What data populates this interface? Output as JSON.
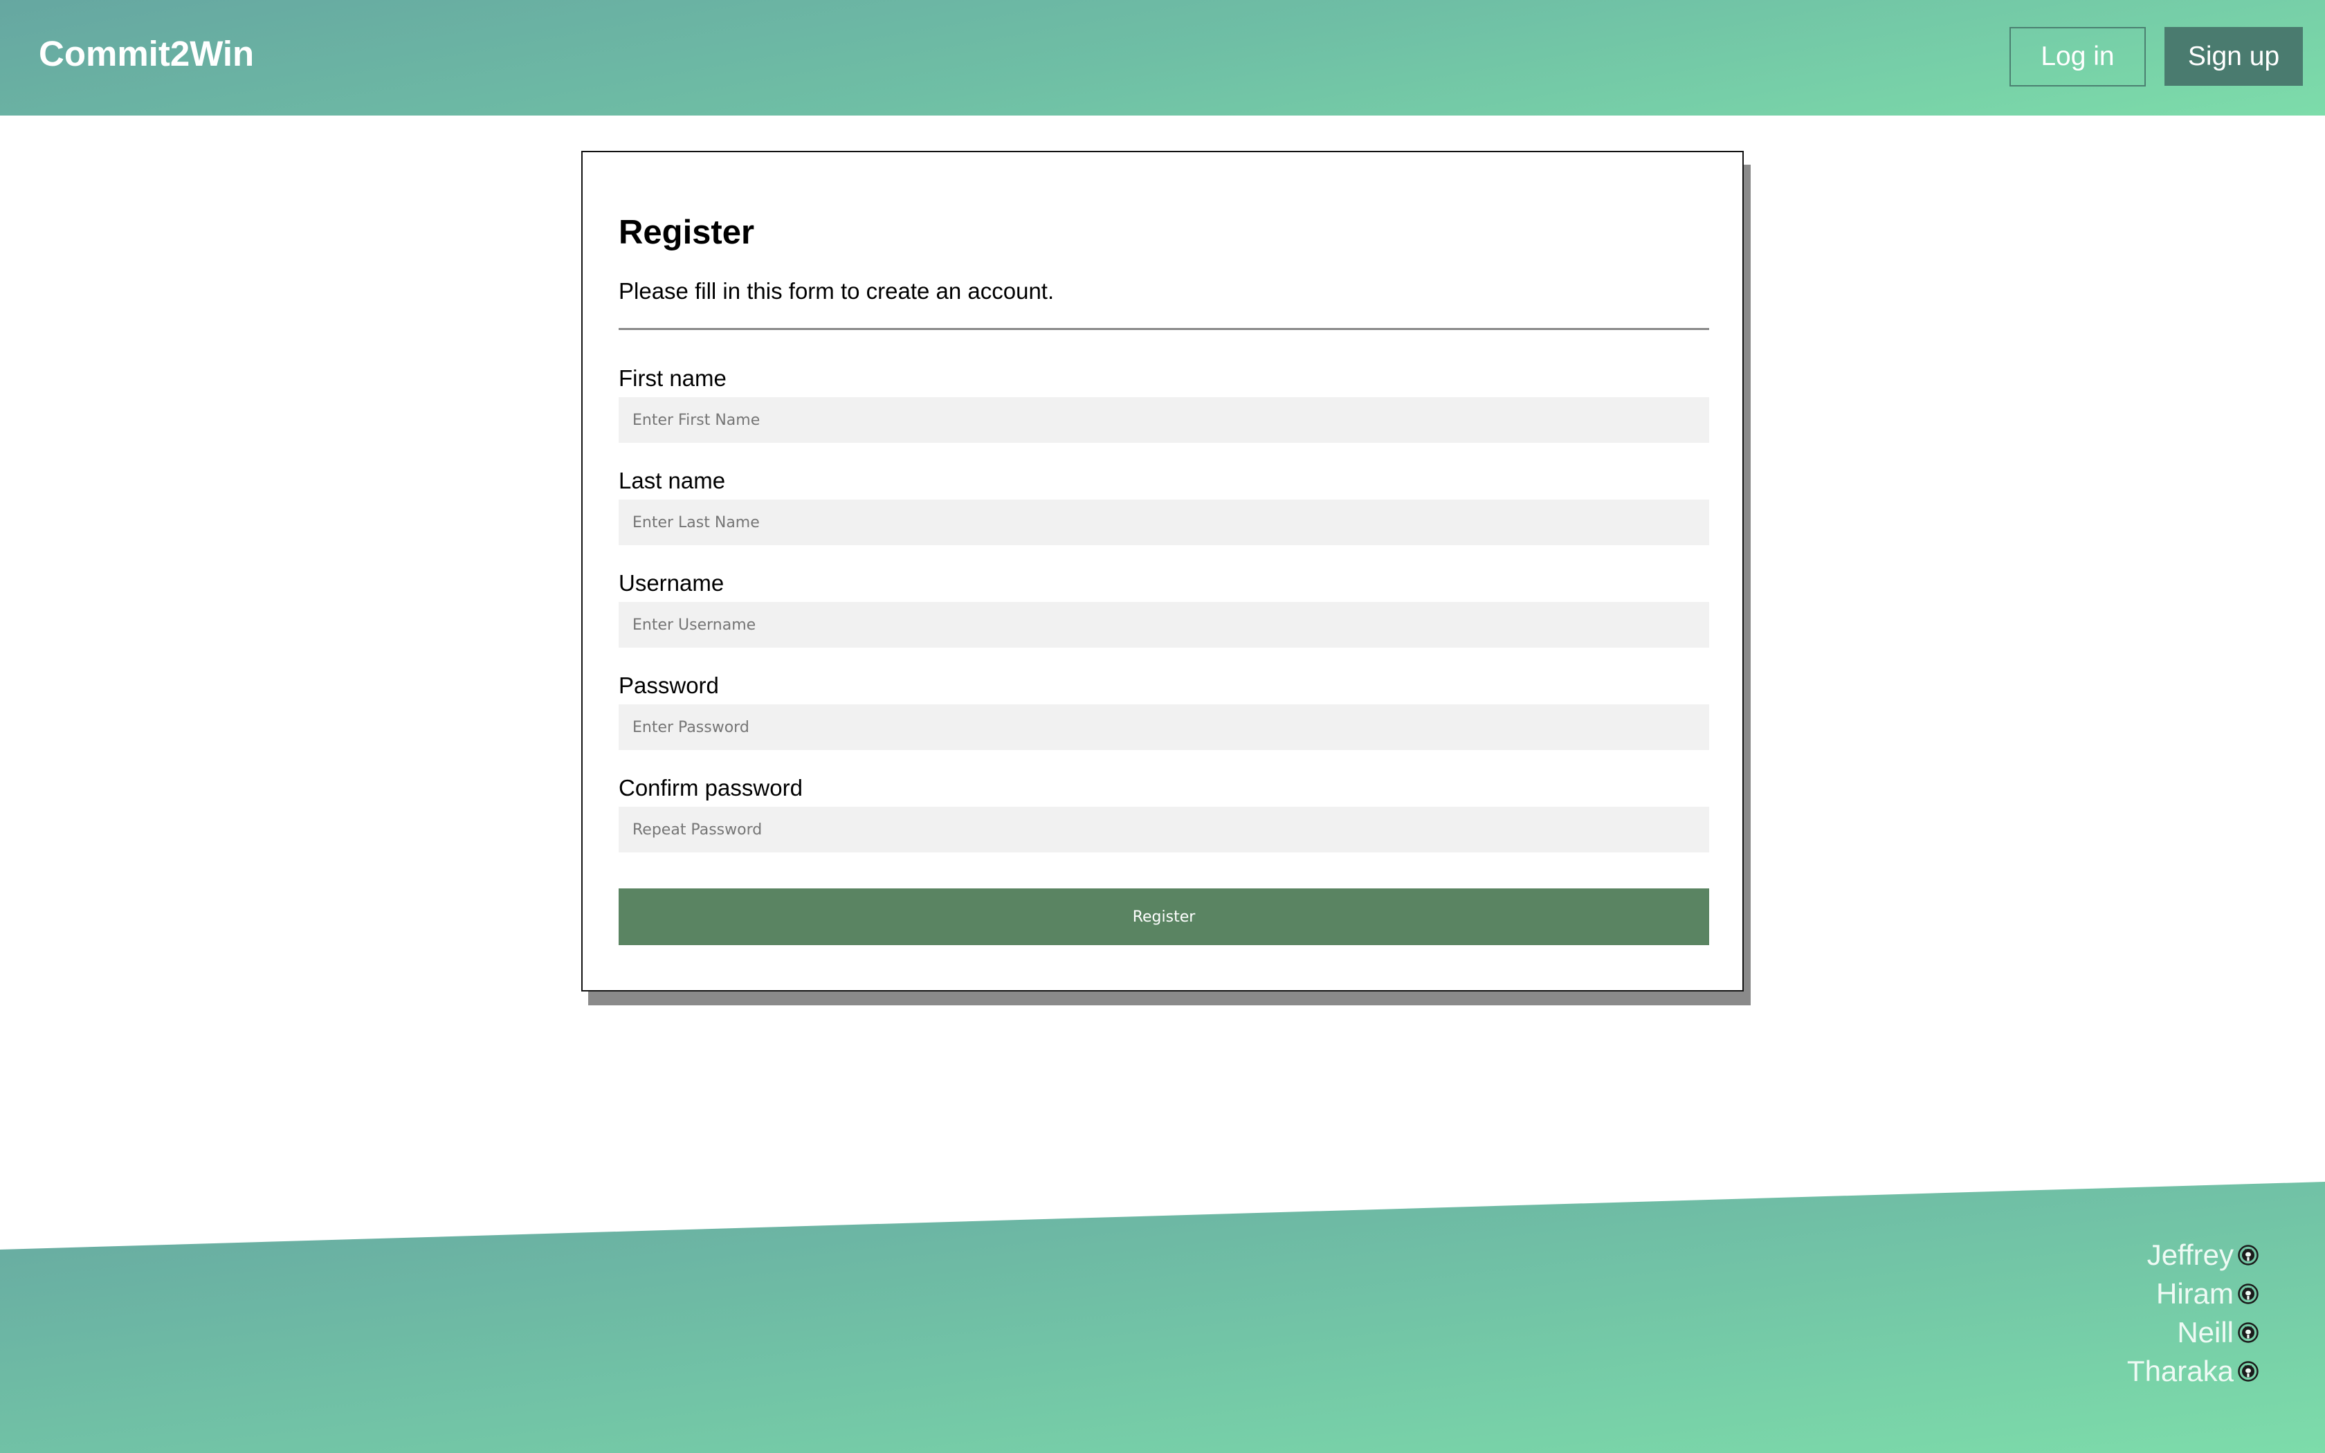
{
  "header": {
    "brand": "Commit2Win",
    "login_label": "Log in",
    "signup_label": "Sign up"
  },
  "form": {
    "title": "Register",
    "subtitle": "Please fill in this form to create an account.",
    "fields": [
      {
        "label": "First name",
        "placeholder": "Enter First Name",
        "value": ""
      },
      {
        "label": "Last name",
        "placeholder": "Enter Last Name",
        "value": ""
      },
      {
        "label": "Username",
        "placeholder": "Enter Username",
        "value": ""
      },
      {
        "label": "Password",
        "placeholder": "Enter Password",
        "value": ""
      },
      {
        "label": "Confirm password",
        "placeholder": "Repeat Password",
        "value": ""
      }
    ],
    "submit_label": "Register"
  },
  "footer": {
    "contributors": [
      {
        "name": "Jeffrey",
        "icon": "github-icon"
      },
      {
        "name": "Hiram",
        "icon": "github-icon"
      },
      {
        "name": "Neill",
        "icon": "github-icon"
      },
      {
        "name": "Tharaka",
        "icon": "github-icon"
      }
    ]
  },
  "colors": {
    "gradient_start": "#66a7a1",
    "gradient_end": "#7ddcaa",
    "signup_button": "#4a7b6f",
    "register_button": "#5a8462",
    "input_background": "#f1f1f1",
    "card_shadow": "#8a8a8a"
  }
}
